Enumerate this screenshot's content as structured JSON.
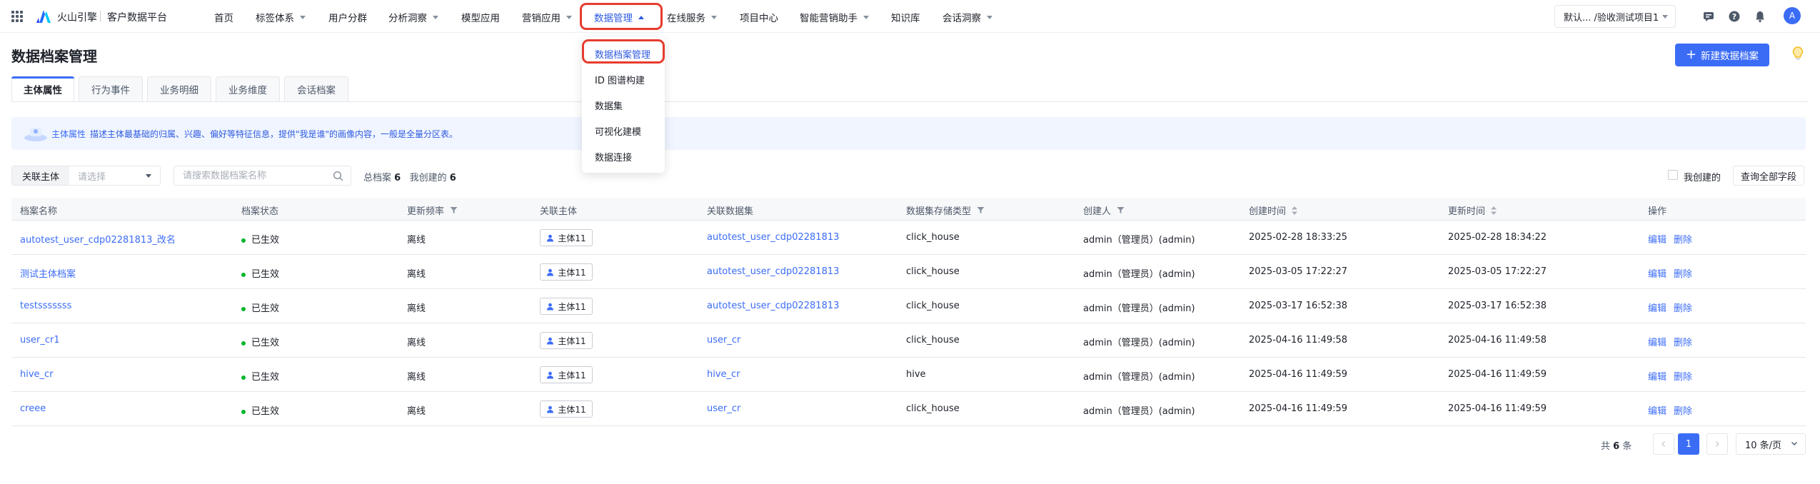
{
  "brand": {
    "name": "火山引擎",
    "product": "客户数据平台"
  },
  "nav": {
    "items": [
      {
        "label": "首页",
        "caret": false
      },
      {
        "label": "标签体系",
        "caret": true
      },
      {
        "label": "用户分群",
        "caret": false
      },
      {
        "label": "分析洞察",
        "caret": true
      },
      {
        "label": "模型应用",
        "caret": false
      },
      {
        "label": "营销应用",
        "caret": true
      },
      {
        "label": "数据管理",
        "caret": true,
        "active": true
      },
      {
        "label": "在线服务",
        "caret": true
      },
      {
        "label": "项目中心",
        "caret": false
      },
      {
        "label": "智能营销助手",
        "caret": true
      },
      {
        "label": "知识库",
        "caret": false
      },
      {
        "label": "会话洞察",
        "caret": true
      }
    ],
    "project_select": "默认... /验收测试项目1",
    "avatar_initial": "A"
  },
  "dropdown": {
    "items": [
      "数据档案管理",
      "ID 图谱构建",
      "数据集",
      "可视化建模",
      "数据连接"
    ]
  },
  "page": {
    "title": "数据档案管理",
    "new_button": "新建数据档案"
  },
  "tabs": [
    "主体属性",
    "行为事件",
    "业务明细",
    "业务维度",
    "会话档案"
  ],
  "banner": {
    "label": "主体属性",
    "text": "描述主体最基础的归属、兴趣、偏好等特征信息，提供\"我是谁\"的画像内容，一般是全量分区表。"
  },
  "filters": {
    "entity_label": "关联主体",
    "entity_placeholder": "请选择",
    "search_placeholder": "请搜索数据档案名称",
    "total_label": "总档案",
    "total_count": "6",
    "mine_label": "我创建的",
    "mine_count": "6",
    "mine_checkbox_label": "我创建的",
    "query_all_button": "查询全部字段"
  },
  "table": {
    "headers": [
      "档案名称",
      "档案状态",
      "更新频率",
      "关联主体",
      "关联数据集",
      "数据集存储类型",
      "创建人",
      "创建时间",
      "更新时间",
      "操作"
    ],
    "rows": [
      {
        "name": "autotest_user_cdp02281813_改名",
        "status": "已生效",
        "freq": "离线",
        "entity": "主体11",
        "dataset": "autotest_user_cdp02281813",
        "storage": "click_house",
        "creator": "admin（管理员）(admin)",
        "created": "2025-02-28 18:33:25",
        "updated": "2025-02-28 18:34:22"
      },
      {
        "name": "测试主体档案",
        "status": "已生效",
        "freq": "离线",
        "entity": "主体11",
        "dataset": "autotest_user_cdp02281813",
        "storage": "click_house",
        "creator": "admin（管理员）(admin)",
        "created": "2025-03-05 17:22:27",
        "updated": "2025-03-05 17:22:27"
      },
      {
        "name": "testsssssss",
        "status": "已生效",
        "freq": "离线",
        "entity": "主体11",
        "dataset": "autotest_user_cdp02281813",
        "storage": "click_house",
        "creator": "admin（管理员）(admin)",
        "created": "2025-03-17 16:52:38",
        "updated": "2025-03-17 16:52:38"
      },
      {
        "name": "user_cr1",
        "status": "已生效",
        "freq": "离线",
        "entity": "主体11",
        "dataset": "user_cr",
        "storage": "click_house",
        "creator": "admin（管理员）(admin)",
        "created": "2025-04-16 11:49:58",
        "updated": "2025-04-16 11:49:58"
      },
      {
        "name": "hive_cr",
        "status": "已生效",
        "freq": "离线",
        "entity": "主体11",
        "dataset": "hive_cr",
        "storage": "hive",
        "creator": "admin（管理员）(admin)",
        "created": "2025-04-16 11:49:59",
        "updated": "2025-04-16 11:49:59"
      },
      {
        "name": "creee",
        "status": "已生效",
        "freq": "离线",
        "entity": "主体11",
        "dataset": "user_cr",
        "storage": "click_house",
        "creator": "admin（管理员）(admin)",
        "created": "2025-04-16 11:49:59",
        "updated": "2025-04-16 11:49:59"
      }
    ],
    "edit_label": "编辑",
    "delete_label": "删除"
  },
  "pagination": {
    "total_prefix": "共",
    "total": "6",
    "total_suffix": "条",
    "current_page": "1",
    "page_size": "10 条/页"
  },
  "colors": {
    "accent": "#3b6cf6",
    "highlight": "#e63b2e",
    "status_ok": "#00b42a"
  }
}
